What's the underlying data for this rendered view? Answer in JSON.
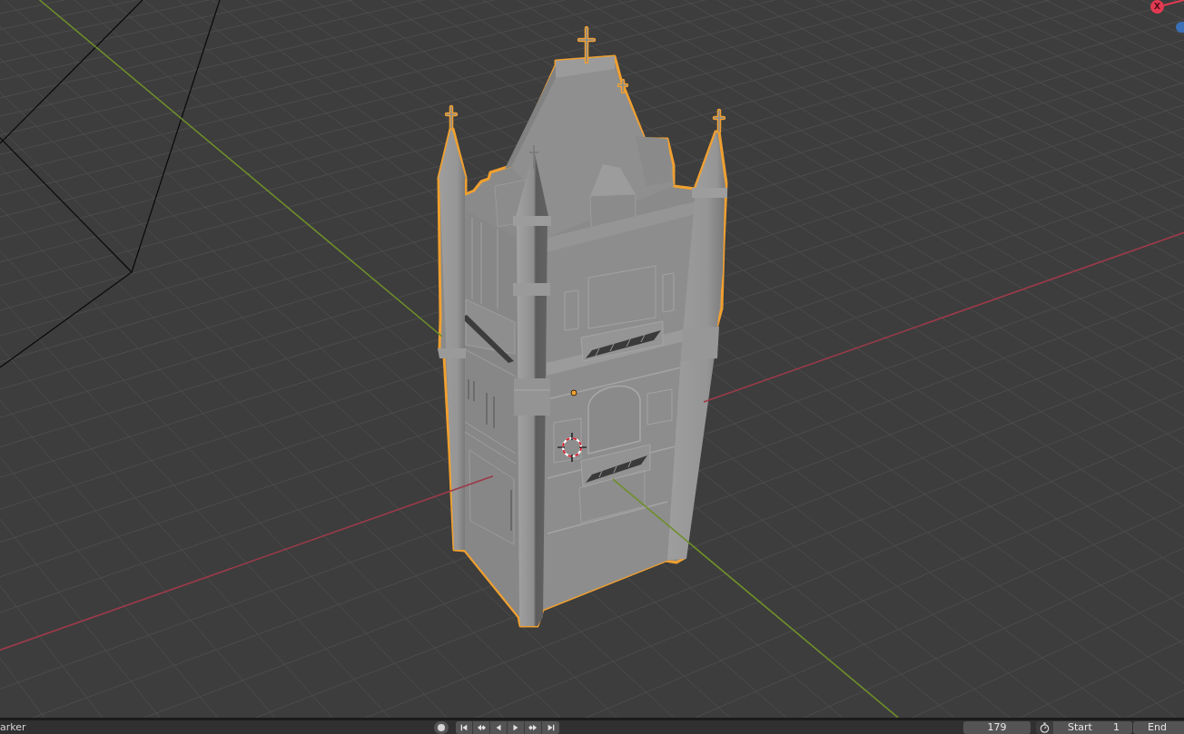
{
  "gizmo": {
    "x_axis_label": "X"
  },
  "timeline": {
    "menu": "arker",
    "auto_keying": {
      "on": false
    },
    "playback": [
      {
        "kind": "jump_start"
      },
      {
        "kind": "prev_key"
      },
      {
        "kind": "play_reverse"
      },
      {
        "kind": "play"
      },
      {
        "kind": "next_key"
      },
      {
        "kind": "jump_end"
      }
    ],
    "current_frame": "179",
    "start": {
      "label": "Start",
      "value": "1"
    },
    "end": {
      "label": "End"
    }
  }
}
